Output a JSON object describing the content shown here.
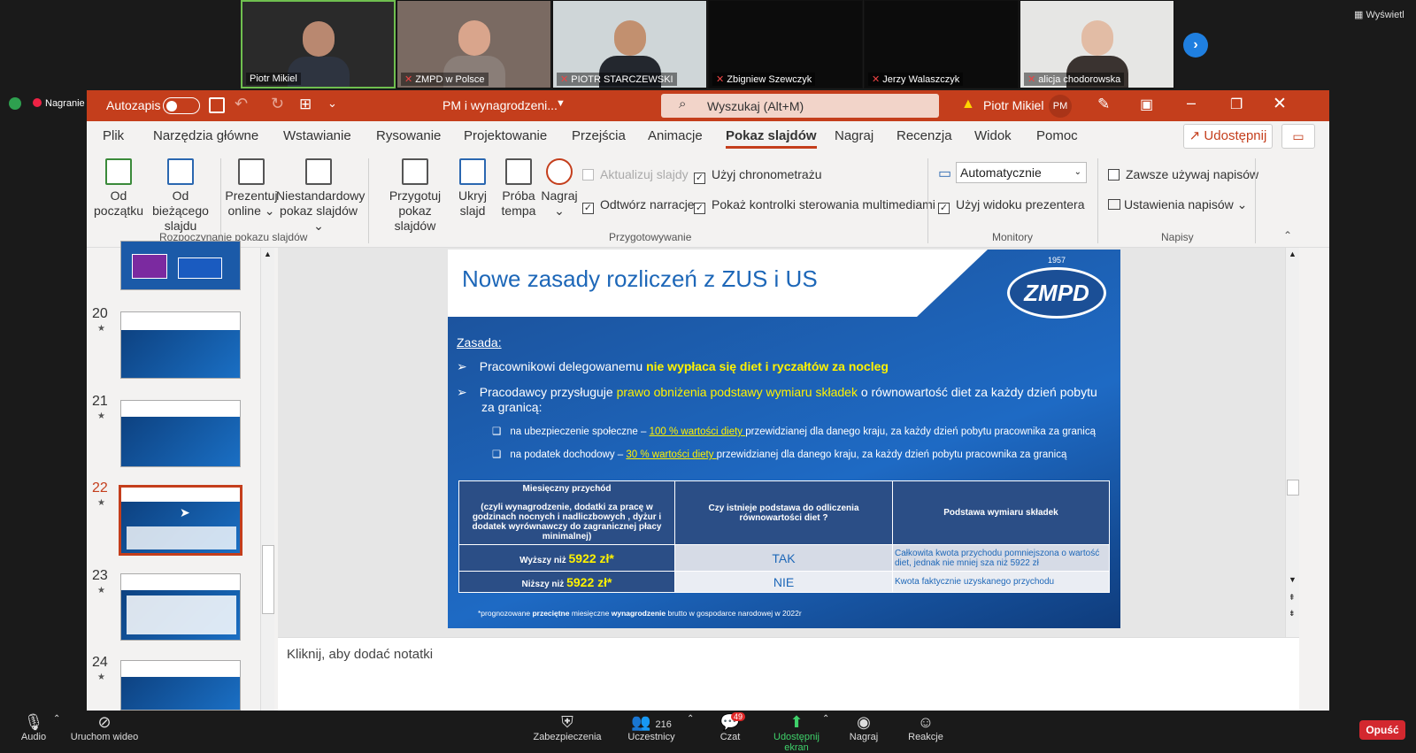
{
  "zoom": {
    "view_label": "Wyświetl",
    "recording_label": "Nagranie",
    "participants": [
      {
        "name": "Piotr Mikiel",
        "muted": false
      },
      {
        "name": "ZMPD w Polsce",
        "muted": true
      },
      {
        "name": "PIOTR STARCZEWSKI",
        "muted": true
      },
      {
        "name": "Zbigniew Szewczyk",
        "muted": true
      },
      {
        "name": "Jerzy Walaszczyk",
        "muted": true
      },
      {
        "name": "alicja chodorowska",
        "muted": true
      }
    ],
    "toolbar": {
      "audio": "Audio",
      "video": "Uruchom wideo",
      "security": "Zabezpieczenia",
      "participants": "Uczestnicy",
      "participants_count": "216",
      "chat": "Czat",
      "chat_badge": "49",
      "share": "Udostępnij ekran",
      "record": "Nagraj",
      "reactions": "Reakcje",
      "leave": "Opuść"
    }
  },
  "ppt": {
    "autosave": "Autozapis",
    "doc_title": "PM i wynagrodzeni...",
    "search_placeholder": "Wyszukaj (Alt+M)",
    "user_name": "Piotr Mikiel",
    "user_initials": "PM",
    "share_button": "Udostępnij",
    "tabs": [
      "Plik",
      "Narzędzia główne",
      "Wstawianie",
      "Rysowanie",
      "Projektowanie",
      "Przejścia",
      "Animacje",
      "Pokaz slajdów",
      "Nagraj",
      "Recenzja",
      "Widok",
      "Pomoc"
    ],
    "active_tab": "Pokaz slajdów",
    "ribbon": {
      "from_start": [
        "Od",
        "początku"
      ],
      "from_current": [
        "Od bieżącego",
        "slajdu"
      ],
      "present_online": [
        "Prezentuj",
        "online ⌄"
      ],
      "custom_show": [
        "Niestandardowy",
        "pokaz slajdów ⌄"
      ],
      "setup_show": [
        "Przygotuj",
        "pokaz slajdów"
      ],
      "hide_slide": [
        "Ukryj",
        "slajd"
      ],
      "rehearse": [
        "Próba",
        "tempa"
      ],
      "record": [
        "Nagraj",
        "⌄"
      ],
      "update_slides": "Aktualizuj slajdy",
      "use_timings": "Użyj chronometrażu",
      "play_narrations": "Odtwórz narracje",
      "show_media_controls": "Pokaż kontrolki sterowania multimediami",
      "monitor_select": "Automatycznie",
      "use_presenter_view": "Użyj widoku prezentera",
      "always_captions": "Zawsze używaj napisów",
      "caption_settings": "Ustawienia napisów ⌄",
      "group_start": "Rozpoczynanie pokazu slajdów",
      "group_setup": "Przygotowywanie",
      "group_monitors": "Monitory",
      "group_captions": "Napisy"
    },
    "thumbnails": [
      "20",
      "21",
      "22",
      "23",
      "24"
    ],
    "selected_slide": "22",
    "notes_placeholder": "Kliknij, aby dodać notatki"
  },
  "slide": {
    "title": "Nowe zasady rozliczeń z ZUS i US",
    "logo_text": "ZMPD",
    "logo_year": "1957",
    "zasada": "Zasada:",
    "b1_prefix": "Pracownikowi delegowanemu ",
    "b1_highlight": "nie wypłaca się diet i ryczałtów za nocleg",
    "b2_prefix": "Pracodawcy przysługuje ",
    "b2_highlight": "prawo obniżenia podstawy wymiaru składek",
    "b2_suffix": "  o  równowartość diet za każdy dzień pobytu za granicą:",
    "s1_prefix": "na ubezpieczenie społeczne – ",
    "s1_highlight": "100 %  wartości diety ",
    "s1_suffix": "przewidzianej dla danego kraju, za każdy dzień pobytu pracownika za granicą",
    "s2_prefix": "na podatek dochodowy – ",
    "s2_highlight": "30 % wartości diety ",
    "s2_suffix": "przewidzianej dla danego kraju, za każdy dzień pobytu pracownika za granicą",
    "table": {
      "h1_title": "Miesięczny przychód",
      "h1_desc": "(czyli wynagrodzenie, dodatki za pracę w godzinach nocnych i nadliczbowych , dyżur i dodatek wyrównawczy do zagranicznej płacy minimalnej)",
      "h2": "Czy istnieje podstawa do odliczenia równowartości diet ?",
      "h3": "Podstawa wymiaru składek",
      "r1_label": "Wyższy niż ",
      "r1_amount": "5922 zł*",
      "r1_answer": "TAK",
      "r1_basis": "Całkowita kwota przychodu pomniejszona o wartość diet, jednak nie mniej sza niż  5922 zł",
      "r2_label": "Niższy niż ",
      "r2_amount": "5922 zł*",
      "r2_answer": "NIE",
      "r2_basis": "Kwota faktycznie uzyskanego przychodu"
    },
    "footnote_a": "*prognozowane ",
    "footnote_b": "przeciętne",
    "footnote_c": " miesięczne ",
    "footnote_d": "wynagrodzenie",
    "footnote_e": " brutto w gospodarce narodowej w 2022r"
  }
}
